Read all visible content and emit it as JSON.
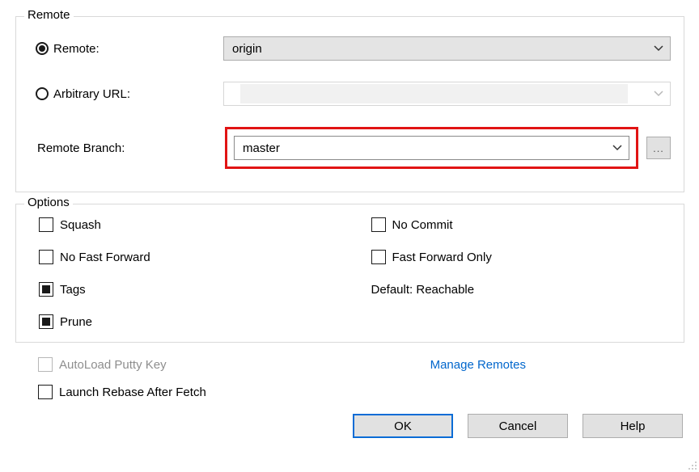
{
  "remote_group": {
    "legend": "Remote",
    "radio_remote_label": "Remote:",
    "radio_url_label": "Arbitrary URL:",
    "remote_value": "origin",
    "url_value": "",
    "branch_label": "Remote Branch:",
    "branch_value": "master",
    "more_label": "..."
  },
  "options_group": {
    "legend": "Options",
    "left": {
      "squash": "Squash",
      "no_ff": "No Fast Forward",
      "tags": "Tags",
      "prune": "Prune"
    },
    "right": {
      "no_commit": "No Commit",
      "ff_only": "Fast Forward Only",
      "default_label": "Default: Reachable"
    }
  },
  "bottom": {
    "autoload": "AutoLoad Putty Key",
    "launch_rebase": "Launch Rebase After Fetch",
    "manage_remotes": "Manage Remotes"
  },
  "buttons": {
    "ok": "OK",
    "cancel": "Cancel",
    "help": "Help"
  }
}
